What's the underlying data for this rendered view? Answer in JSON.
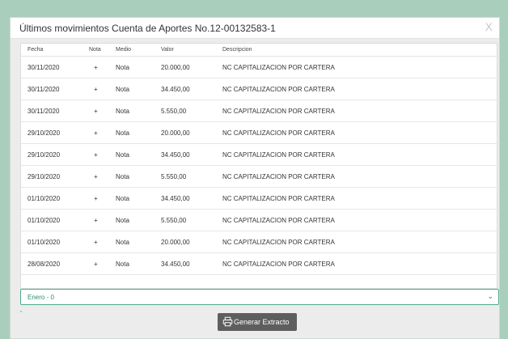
{
  "dialog": {
    "title": "Últimos movimientos Cuenta de Aportes No.12-00132583-1",
    "close_label": "X"
  },
  "table": {
    "headers": [
      "Fecha",
      "Nota",
      "Medio",
      "Valor",
      "Descripcion"
    ],
    "rows": [
      [
        "30/11/2020",
        "+",
        "Nota",
        "20.000,00",
        "NC CAPITALIZACION POR CARTERA"
      ],
      [
        "30/11/2020",
        "+",
        "Nota",
        "34.450,00",
        "NC CAPITALIZACION POR CARTERA"
      ],
      [
        "30/11/2020",
        "+",
        "Nota",
        "5.550,00",
        "NC CAPITALIZACION POR CARTERA"
      ],
      [
        "29/10/2020",
        "+",
        "Nota",
        "20.000,00",
        "NC CAPITALIZACION POR CARTERA"
      ],
      [
        "29/10/2020",
        "+",
        "Nota",
        "34.450,00",
        "NC CAPITALIZACION POR CARTERA"
      ],
      [
        "29/10/2020",
        "+",
        "Nota",
        "5.550,00",
        "NC CAPITALIZACION POR CARTERA"
      ],
      [
        "01/10/2020",
        "+",
        "Nota",
        "34.450,00",
        "NC CAPITALIZACION POR CARTERA"
      ],
      [
        "01/10/2020",
        "+",
        "Nota",
        "5.550,00",
        "NC CAPITALIZACION POR CARTERA"
      ],
      [
        "01/10/2020",
        "+",
        "Nota",
        "20.000,00",
        "NC CAPITALIZACION POR CARTERA"
      ],
      [
        "28/08/2020",
        "+",
        "Nota",
        "34.450,00",
        "NC CAPITALIZACION POR CARTERA"
      ]
    ]
  },
  "period_select": {
    "value": "Enero - 0",
    "icon": "chevron-down-icon"
  },
  "extract_button": {
    "label": "Generar Extracto",
    "icon": "printer-icon"
  },
  "colors": {
    "background": "#a9cfbc",
    "select_border": "#4cae8a",
    "button": "#5e5e5e"
  }
}
